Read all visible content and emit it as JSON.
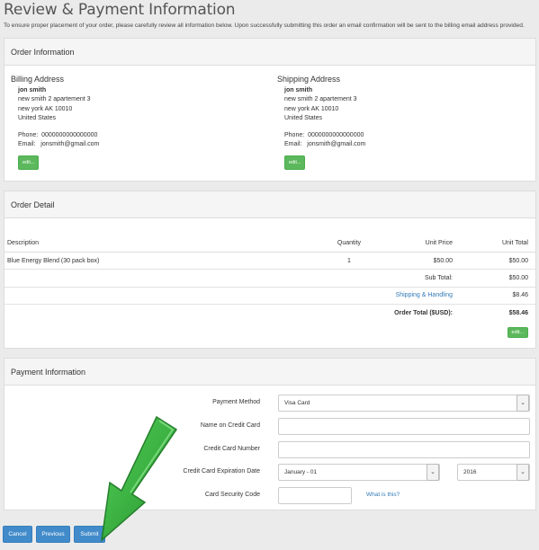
{
  "page": {
    "title": "Review & Payment Information",
    "intro": "To ensure proper placement of your order, please carefully review all information below. Upon successfully submitting this order an email confirmation will be sent to the billing email address provided."
  },
  "order_info": {
    "heading": "Order Information",
    "billing": {
      "title": "Billing Address",
      "name": "jon smith",
      "street": "new smith 2 apartement 3",
      "city_line": "new york AK 10010",
      "country": "United States",
      "phone_label": "Phone:",
      "phone": "0000000000000000",
      "email_label": "Email:",
      "email": "jonsmith@gmail.com",
      "edit_label": "edit..."
    },
    "shipping": {
      "title": "Shipping Address",
      "name": "jon smith",
      "street": "new smith 2 apartement 3",
      "city_line": "new york AK 10010",
      "country": "United States",
      "phone_label": "Phone:",
      "phone": "0000000000000000",
      "email_label": "Email:",
      "email": "jonsmith@gmail.com",
      "edit_label": "edit..."
    }
  },
  "order_detail": {
    "heading": "Order Detail",
    "columns": [
      "Description",
      "Quantity",
      "Unit Price",
      "Unit Total"
    ],
    "item": {
      "description": "Blue Energy Blend (30 pack box)",
      "quantity": "1",
      "unit_price": "$50.00",
      "unit_total": "$50.00"
    },
    "sub_total_label": "Sub Total:",
    "sub_total": "$50.00",
    "shipping_label": "Shipping & Handling",
    "shipping": "$8.46",
    "order_total_label": "Order Total ($USD):",
    "order_total": "$58.46",
    "edit_label": "edit..."
  },
  "payment": {
    "heading": "Payment Information",
    "method_label": "Payment Method",
    "method_value": "Visa Card",
    "name_label": "Name on Credit Card",
    "number_label": "Credit Card Number",
    "expiration_label": "Credit Card Expiration Date",
    "exp_month": "January - 01",
    "exp_year": "2016",
    "security_label": "Card Security Code",
    "what_is_this": "What is this?"
  },
  "buttons": {
    "cancel": "Cancel",
    "previous": "Previous",
    "submit": "Submit"
  },
  "colors": {
    "primary_button": "#428bca",
    "edit_button": "#5cb85c",
    "arrow": "#2fa836",
    "link": "#337ab7"
  }
}
